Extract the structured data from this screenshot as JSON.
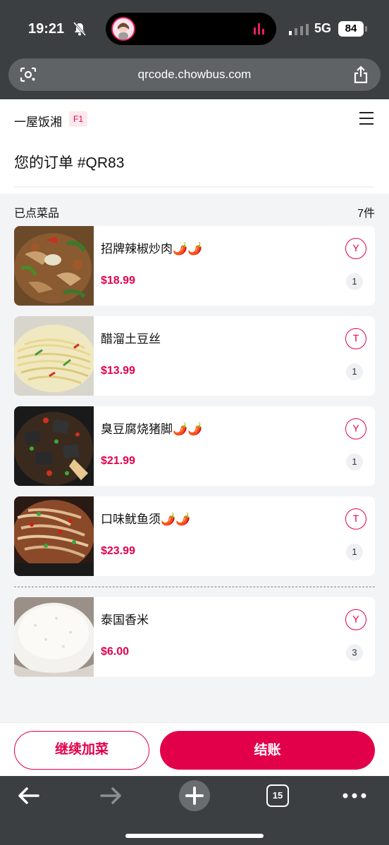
{
  "status_bar": {
    "time": "19:21",
    "network": "5G",
    "battery": "84"
  },
  "browser": {
    "url": "qrcode.chowbus.com",
    "tab_count": "15"
  },
  "header": {
    "restaurant": "一屋饭湘",
    "table": "F1"
  },
  "order": {
    "title": "您的订单 #QR83"
  },
  "section": {
    "label": "已点菜品",
    "count": "7件"
  },
  "items": [
    {
      "name": "招牌辣椒炒肉🌶️🌶️",
      "price": "$18.99",
      "tag": "Y",
      "qty": "1"
    },
    {
      "name": "醋溜土豆丝",
      "price": "$13.99",
      "tag": "T",
      "qty": "1"
    },
    {
      "name": "臭豆腐烧猪脚🌶️🌶️",
      "price": "$21.99",
      "tag": "Y",
      "qty": "1"
    },
    {
      "name": "口味鱿鱼须🌶️🌶️",
      "price": "$23.99",
      "tag": "T",
      "qty": "1"
    },
    {
      "name": "泰国香米",
      "price": "$6.00",
      "tag": "Y",
      "qty": "3"
    }
  ],
  "actions": {
    "continue_label": "继续加菜",
    "checkout_label": "结账"
  },
  "colors": {
    "accent": "#e3004b",
    "chrome": "#3c3f41"
  }
}
